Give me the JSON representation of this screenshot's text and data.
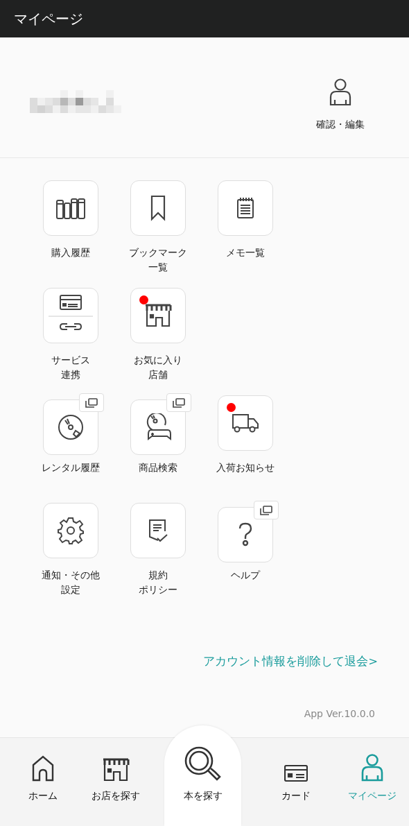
{
  "header": {
    "title": "マイページ"
  },
  "profile": {
    "edit_label": "確認・編集"
  },
  "menu_rows": [
    [
      {
        "label_lines": [
          "購入履歴"
        ],
        "new": false,
        "external": false
      },
      {
        "label_lines": [
          "ブックマーク",
          "一覧"
        ],
        "new": false,
        "external": false
      },
      {
        "label_lines": [
          "メモ一覧"
        ],
        "new": false,
        "external": false
      }
    ],
    [
      {
        "label_lines": [
          "サービス",
          "連携"
        ],
        "new": false,
        "external": false
      },
      {
        "label_lines": [
          "お気に入り",
          "店舗"
        ],
        "new": true,
        "external": false
      }
    ],
    [
      {
        "label_lines": [
          "レンタル履歴"
        ],
        "new": false,
        "external": true
      },
      {
        "label_lines": [
          "商品検索"
        ],
        "new": false,
        "external": true
      },
      {
        "label_lines": [
          "入荷お知らせ"
        ],
        "new": true,
        "external": false
      }
    ],
    [
      {
        "label_lines": [
          "通知・その他",
          "設定"
        ],
        "new": false,
        "external": false
      },
      {
        "label_lines": [
          "規約",
          "ポリシー"
        ],
        "new": false,
        "external": false
      },
      {
        "label_lines": [
          "ヘルプ"
        ],
        "new": false,
        "external": true
      }
    ]
  ],
  "withdraw_link": "アカウント情報を削除して退会>",
  "version": "App Ver.10.0.0",
  "bottom_nav": [
    {
      "label": "ホーム",
      "kind": "tab",
      "selected": false
    },
    {
      "label": "お店を探す",
      "kind": "tab",
      "selected": false
    },
    {
      "label": "本を探す",
      "kind": "featured",
      "selected": false
    },
    {
      "label": "カード",
      "kind": "tab",
      "selected": false
    },
    {
      "label": "マイページ",
      "kind": "tab",
      "selected": true
    }
  ]
}
